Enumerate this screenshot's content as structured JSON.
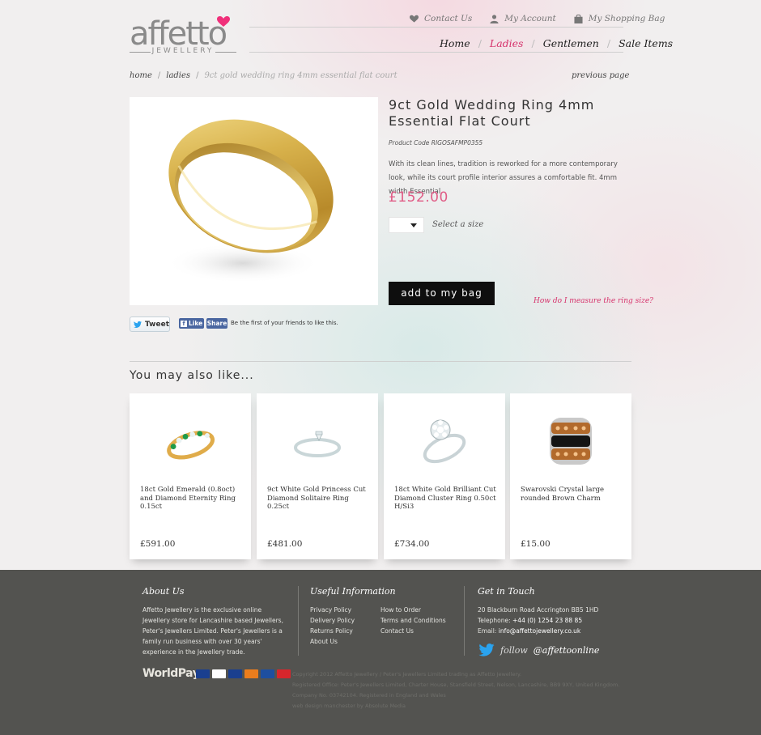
{
  "header": {
    "logo_text": "affetto",
    "logo_sub": "JEWELLERY",
    "top_links": [
      "Contact Us",
      "My Account",
      "My Shopping Bag"
    ],
    "nav": [
      "Home",
      "Ladies",
      "Gentlemen",
      "Sale Items"
    ],
    "nav_active": "Ladies"
  },
  "breadcrumb": {
    "items": [
      "home",
      "ladies"
    ],
    "current": "9ct gold wedding ring 4mm essential flat court",
    "previous_page": "previous page"
  },
  "product": {
    "title": "9ct Gold Wedding Ring 4mm Essential Flat Court",
    "code": "Product Code RIGOSAFMP0355",
    "description": "With its clean lines, tradition is reworked for a more contemporary look, while its court profile interior assures a comfortable fit. 4mm width Essential",
    "price": "£152.00",
    "size_label": "Select a size",
    "add_button": "add to my bag",
    "ring_size_link": "How do I measure the ring size?"
  },
  "social": {
    "tweet": "Tweet",
    "like": "Like",
    "share": "Share",
    "fb_text": "Be the first of your friends to like this."
  },
  "related": {
    "heading": "You may also like...",
    "items": [
      {
        "name": "18ct Gold Emerald (0.8oct) and Diamond Eternity Ring 0.15ct",
        "price": "£591.00"
      },
      {
        "name": "9ct White Gold Princess Cut Diamond Solitaire Ring 0.25ct",
        "price": "£481.00"
      },
      {
        "name": "18ct White Gold Brilliant Cut Diamond Cluster Ring 0.50ct H/Si3",
        "price": "£734.00"
      },
      {
        "name": "Swarovski Crystal large rounded Brown Charm",
        "price": "£15.00"
      }
    ]
  },
  "footer": {
    "about_heading": "About Us",
    "about_text": "Affetto Jewellery is the exclusive online Jewellery store for Lancashire based Jewellers, Peter's Jewellers Limited. Peter's Jewellers is a family run business with over 30 years' experience in the Jewellery trade.",
    "useful_heading": "Useful Information",
    "useful_col1": [
      "Privacy Policy",
      "Delivery Policy",
      "Returns Policy",
      "About Us"
    ],
    "useful_col2": [
      "How to Order",
      "Terms and Conditions",
      "Contact Us"
    ],
    "touch_heading": "Get in Touch",
    "address": "20 Blackburn Road Accrington BB5 1HD",
    "telephone_label": "Telephone:",
    "telephone": "+44 (0) 1254 23 88 85",
    "email_label": "Email:",
    "email": "info@affettojewellery.co.uk",
    "follow": "follow",
    "handle": "@affettoonline",
    "worldpay": "WorldPay",
    "copyright_lines": [
      "Copyright 2012 Affetto Jewellery / Peter's Jewellers Limited trading as Affetto Jewellery.",
      "Registered Office: Peter's Jewellers Limited, Charter House, Stansfield Street, Nelson, Lancashire, BB9 9XY, United Kingdom.",
      "Company No. 03742104. Registered in England and Wales",
      "web design manchester by Absolute Media"
    ]
  },
  "colors": {
    "accent": "#d6336c",
    "price": "#e05c86",
    "footer_bg": "#535350",
    "button_bg": "#0e0e0e"
  }
}
